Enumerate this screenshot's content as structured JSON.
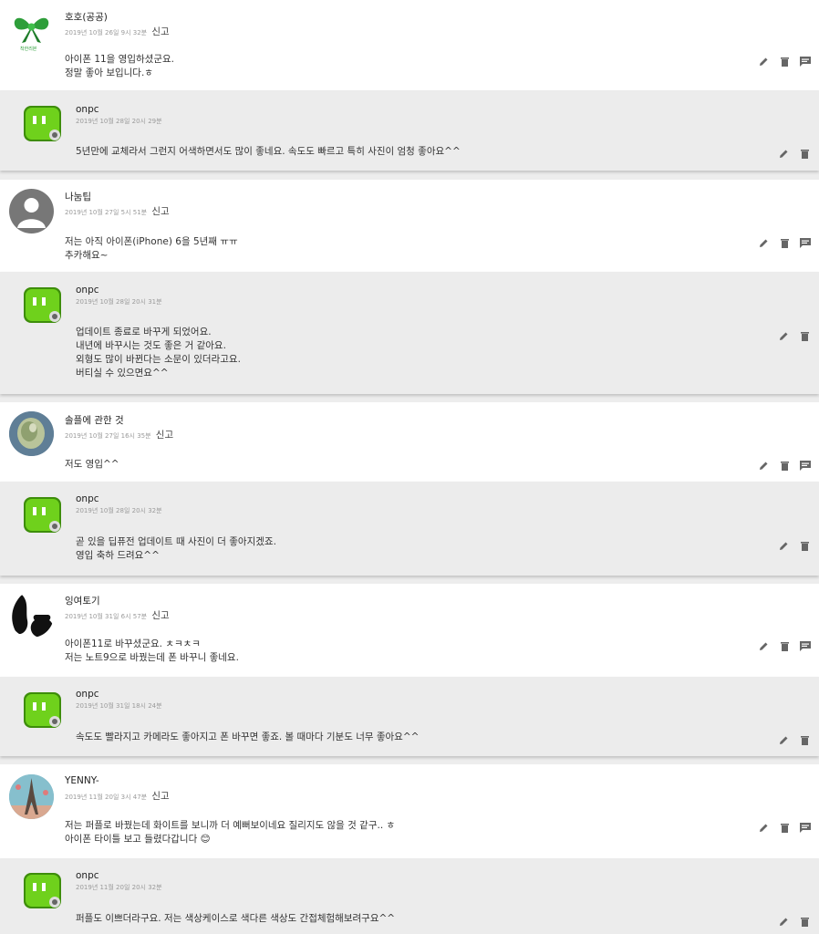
{
  "report_label": "신고",
  "threads": [
    {
      "comment": {
        "name": "호호(공공)",
        "date": "2019년 10월 26일 9시 32분",
        "text": "아이폰 11을 영입하셨군요.\n정말 좋아 보입니다.ㅎ",
        "avatar": "green-ribbon-avatar",
        "avatar_caption": "착한리본"
      },
      "reply": {
        "name": "onpc",
        "date": "2019년 10월 28일 20시 29분",
        "text": "5년만에 교체라서 그런지 어색하면서도 많이 좋네요. 속도도 빠르고 특히 사진이 엄청 좋아요^^"
      }
    },
    {
      "comment": {
        "name": "나눔팁",
        "date": "2019년 10월 27일 5시 51분",
        "text": "저는 아직 아이폰(iPhone) 6을 5년째 ㅠㅠ\n추카해요~",
        "avatar": "default-user-avatar"
      },
      "reply": {
        "name": "onpc",
        "date": "2019년 10월 28일 20시 31분",
        "text": "업데이트 종료로 바꾸게 되었어요.\n내년에 바꾸시는 것도 좋은 거 같아요.\n외형도 많이 바뀐다는 소문이 있더라고요.\n버티실 수 있으면요^^"
      }
    },
    {
      "comment": {
        "name": "솔플에 관한 것",
        "date": "2019년 10월 27일 16시 35분",
        "text": "저도 영입^^",
        "avatar": "photo-avatar"
      },
      "reply": {
        "name": "onpc",
        "date": "2019년 10월 28일 20시 32분",
        "text": "곧 있을 딥퓨전 업데이트 때 사진이 더 좋아지겠죠.\n영입 축하 드려요^^"
      }
    },
    {
      "comment": {
        "name": "잉여토기",
        "date": "2019년 10월 31일 6시 57분",
        "text": "아이폰11로 바꾸셨군요. ㅊㅋㅊㅋ\n저는 노트9으로 바꿨는데 폰 바꾸니 좋네요.",
        "avatar": "pottery-avatar"
      },
      "reply": {
        "name": "onpc",
        "date": "2019년 10월 31일 18시 24분",
        "text": "속도도 빨라지고 카메라도 좋아지고 폰 바꾸면 좋죠. 볼 때마다 기분도 너무 좋아요^^"
      }
    },
    {
      "comment": {
        "name": "YENNY-",
        "date": "2019년 11월 20일 3시 47분",
        "text": "저는 퍼플로 바꿨는데 화이트를 보니까 더 예뻐보이네요 질리지도 않을 것 같구.. ㅎ\n아이폰 타이틀 보고 들렸다갑니다 😊",
        "avatar": "eiffel-avatar"
      },
      "reply": {
        "name": "onpc",
        "date": "2019년 11월 20일 20시 32분",
        "text": "퍼플도 이쁘더라구요. 저는 색상케이스로 색다른 색상도 간접체험해보려구요^^"
      }
    }
  ]
}
